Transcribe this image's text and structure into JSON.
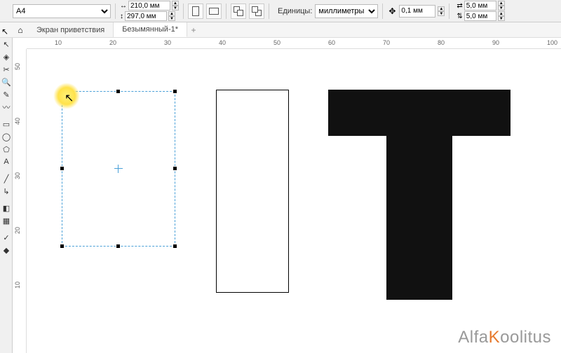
{
  "propbar": {
    "page_preset": "A4",
    "width": "210,0 мм",
    "height": "297,0 мм",
    "units_label": "Единицы:",
    "units_value": "миллиметры",
    "nudge": "0,1 мм",
    "dup_x": "5,0 мм",
    "dup_y": "5,0 мм"
  },
  "tabs": {
    "welcome": "Экран приветствия",
    "doc": "Безымянный-1*"
  },
  "ruler_h": [
    "10",
    "20",
    "30",
    "40",
    "50",
    "60",
    "70",
    "80",
    "90",
    "100"
  ],
  "ruler_v": [
    "50",
    "40",
    "30",
    "20",
    "10"
  ],
  "watermark": {
    "pre": "Alfa",
    "k": "K",
    "rest": "oolitus"
  }
}
